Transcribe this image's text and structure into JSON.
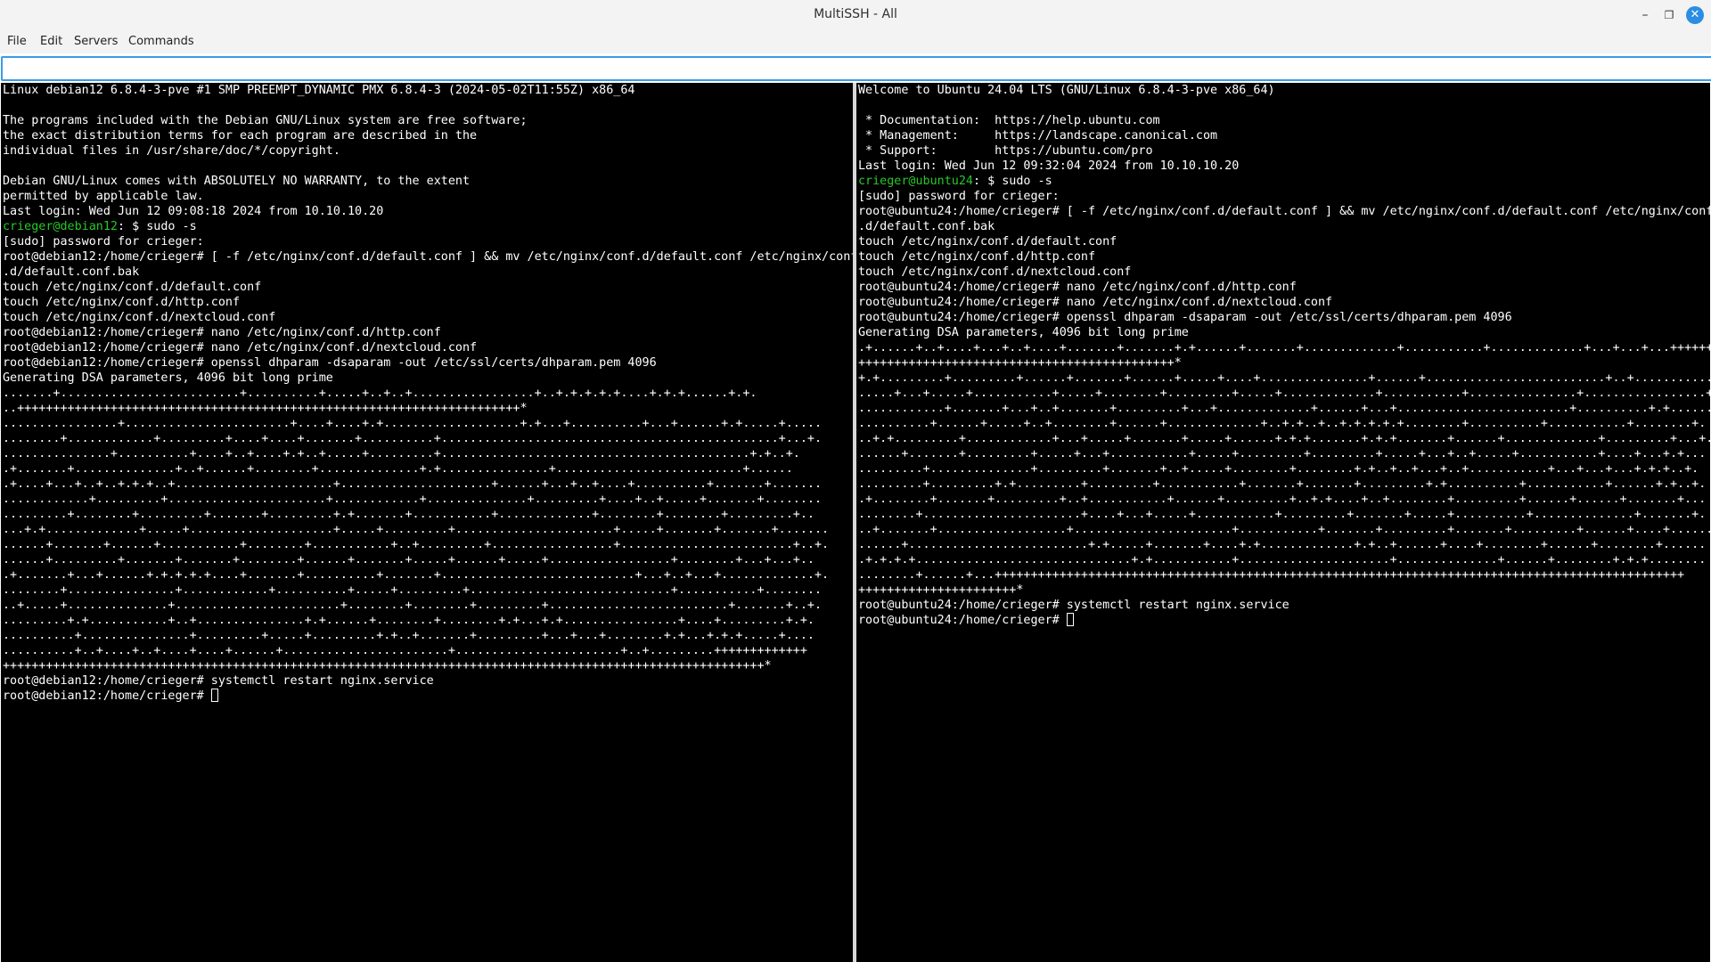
{
  "window": {
    "title": "MultiSSH - All",
    "minimize_icon": "minimize-icon",
    "maximize_icon": "maximize-icon",
    "close_icon": "close-icon",
    "accent": "#2b8ee2"
  },
  "menu": {
    "file": "File",
    "edit": "Edit",
    "servers": "Servers",
    "commands": "Commands"
  },
  "command_input": {
    "value": "",
    "placeholder": ""
  },
  "colors": {
    "terminal_bg": "#000000",
    "terminal_fg": "#ffffff",
    "prompt_user": "#28c828"
  },
  "terminals": {
    "left": {
      "host": "debian12",
      "lines": [
        {
          "text": "Linux debian12 6.8.4-3-pve #1 SMP PREEMPT_DYNAMIC PMX 6.8.4-3 (2024-05-02T11:55Z) x86_64"
        },
        {
          "text": ""
        },
        {
          "text": "The programs included with the Debian GNU/Linux system are free software;"
        },
        {
          "text": "the exact distribution terms for each program are described in the"
        },
        {
          "text": "individual files in /usr/share/doc/*/copyright."
        },
        {
          "text": ""
        },
        {
          "text": "Debian GNU/Linux comes with ABSOLUTELY NO WARRANTY, to the extent"
        },
        {
          "text": "permitted by applicable law."
        },
        {
          "text": "Last login: Wed Jun 12 09:08:18 2024 from 10.10.10.20"
        },
        {
          "prompt": "crieger@debian12",
          "text": ": $ sudo -s"
        },
        {
          "text": "[sudo] password for crieger:"
        },
        {
          "text": "root@debian12:/home/crieger# [ -f /etc/nginx/conf.d/default.conf ] && mv /etc/nginx/conf.d/default.conf /etc/nginx/conf"
        },
        {
          "text": ".d/default.conf.bak"
        },
        {
          "text": "touch /etc/nginx/conf.d/default.conf"
        },
        {
          "text": "touch /etc/nginx/conf.d/http.conf"
        },
        {
          "text": "touch /etc/nginx/conf.d/nextcloud.conf"
        },
        {
          "text": "root@debian12:/home/crieger# nano /etc/nginx/conf.d/http.conf"
        },
        {
          "text": "root@debian12:/home/crieger# nano /etc/nginx/conf.d/nextcloud.conf"
        },
        {
          "text": "root@debian12:/home/crieger# openssl dhparam -dsaparam -out /etc/ssl/certs/dhparam.pem 4096"
        },
        {
          "text": "Generating DSA parameters, 4096 bit long prime"
        },
        {
          "text": ".......+.........................+..........+.....+..+..+.................+..+.+.+.+.+....+.+.+......+.+."
        },
        {
          "text": "..++++++++++++++++++++++++++++++++++++++++++++++++++++++++++++++++++++++*"
        },
        {
          "text": "................+.......................+....+....+.+...................+.+...+..........+...+......+.+.....+....."
        },
        {
          "text": "........+............+.........+....+....+.......+..........+...............................................+...+."
        },
        {
          "text": "...............+..........+....+..+....+.+..+.....+.........+...........................................+.+..+."
        },
        {
          "text": ".+.......+..............+..+......+........+..............+.+...............+..........................+......"
        },
        {
          "text": ".+....+...+..+..+.+.+..+......................+.....................+......+...+..+....+..........+.......+......."
        },
        {
          "text": "............+.........+......................+............+..............+.........+....+..+.....+.......+........"
        },
        {
          "text": ".........+........+.........+.......+.........+.+.......+...........+.............+........+........+.........+.."
        },
        {
          "text": "...+.+.............+.....+....................+.....+.........+......................+.....+.......+.......+......."
        },
        {
          "text": "......+.......+......+...........+........+...........+..+.........+.................+........................+..+."
        },
        {
          "text": "......+.........+.......+.......+........+......+.......+.....+......+.....+.................+........+...+...+.."
        },
        {
          "text": ".+.......+...+......+.+.+.+.+....+.......+..........+.......+...........................+...+..+...+.............+."
        },
        {
          "text": "........+...............+............+..........+.....+.........+............................+...........+........"
        },
        {
          "text": "..+.....+..............+.......................+........+........+.........+.........................+.......+..+."
        },
        {
          "text": ".........+.+...........+..+...............+.+......+........+........+.+...+.+................+....+.........+.+."
        },
        {
          "text": "..........+...............+.........+.....+.........+.+..+.......+.........+...+...+........+.+...+.+.+.....+...."
        },
        {
          "text": "..........+..+....+..+....+....+......+.......................+.......................+..+.........+++++++++++++"
        },
        {
          "text": "++++++++++++++++++++++++++++++++++++++++++++++++++++++++++++++++++++++++++++++++++++++++++++++++++++++++++*"
        },
        {
          "text": "root@debian12:/home/crieger# systemctl restart nginx.service"
        },
        {
          "text": "root@debian12:/home/crieger# ",
          "cursor": true
        }
      ]
    },
    "right": {
      "host": "ubuntu24",
      "lines": [
        {
          "text": "Welcome to Ubuntu 24.04 LTS (GNU/Linux 6.8.4-3-pve x86_64)"
        },
        {
          "text": ""
        },
        {
          "text": " * Documentation:  https://help.ubuntu.com"
        },
        {
          "text": " * Management:     https://landscape.canonical.com"
        },
        {
          "text": " * Support:        https://ubuntu.com/pro"
        },
        {
          "text": "Last login: Wed Jun 12 09:32:04 2024 from 10.10.10.20"
        },
        {
          "prompt": "crieger@ubuntu24",
          "text": ": $ sudo -s"
        },
        {
          "text": "[sudo] password for crieger:"
        },
        {
          "text": "root@ubuntu24:/home/crieger# [ -f /etc/nginx/conf.d/default.conf ] && mv /etc/nginx/conf.d/default.conf /etc/nginx/conf"
        },
        {
          "text": ".d/default.conf.bak"
        },
        {
          "text": "touch /etc/nginx/conf.d/default.conf"
        },
        {
          "text": "touch /etc/nginx/conf.d/http.conf"
        },
        {
          "text": "touch /etc/nginx/conf.d/nextcloud.conf"
        },
        {
          "text": "root@ubuntu24:/home/crieger# nano /etc/nginx/conf.d/http.conf"
        },
        {
          "text": "root@ubuntu24:/home/crieger# nano /etc/nginx/conf.d/nextcloud.conf"
        },
        {
          "text": "root@ubuntu24:/home/crieger# openssl dhparam -dsaparam -out /etc/ssl/certs/dhparam.pem 4096"
        },
        {
          "text": "Generating DSA parameters, 4096 bit long prime"
        },
        {
          "text": ".+......+..+....+...+..+....+.......+.......+.+......+.......+.............+...........+.............+...+...+...++++++++++++++++++"
        },
        {
          "text": "++++++++++++++++++++++++++++++++++++++++++++*"
        },
        {
          "text": "+.+.........+.........+......+.......+......+.....+....+...............+......+.........................+..+..........."
        },
        {
          "text": ".....+...+.....+...........+.....+........+.........+.....+.............+...........+...............+.................+."
        },
        {
          "text": "............+.......+...+..+.......+.........+...+.............+......+...+........................+..........+.+......+."
        },
        {
          "text": "..........+......+.....+..+........+......+.............+..+.+..+..+.+.+.+.+........+..........+...........+........+."
        },
        {
          "text": "..+.+.........+............+...+.....+.......+.....+......+.+.+.......+.+.+.......+......+.............+.........+...+."
        },
        {
          "text": "......+.......+.........+.....+...+...........+.....+.........+.........+.....+...+..+.....+...........+....+...+.+..."
        },
        {
          "text": ".........+..............+.........+.......+..+.....+........+........+.+..+..+...+..+...........+...+...+...+.+.+..+."
        },
        {
          "text": ".........+.........+.+.........+.........+...........+.......+.......+.........+.+..........+...........+......+.+..+."
        },
        {
          "text": ".+........+.......+.........+..+...........+......+.........+..+.+....+..+........+.........+......+......+.......+..."
        },
        {
          "text": "........+......................+....+...+.....+...........+.........+.......+.....+..........+..............+.......+."
        },
        {
          "text": "..+.......+..................+......................+...........+.......+.........+.......+.........+......+....+......"
        },
        {
          "text": "......+.........................+.+.....+.......+....+.+.............+.+..+......+....+........+......+........+......"
        },
        {
          "text": ".+.+.+.+..............................+.+...........+.....................+..............+......+........+.+.+........"
        },
        {
          "text": "........+......+...++++++++++++++++++++++++++++++++++++++++++++++++++++++++++++++++++++++++++++++++++++++++++++++++"
        },
        {
          "text": "++++++++++++++++++++++*"
        },
        {
          "text": "root@ubuntu24:/home/crieger# systemctl restart nginx.service"
        },
        {
          "text": "root@ubuntu24:/home/crieger# ",
          "cursor": true
        }
      ]
    }
  }
}
